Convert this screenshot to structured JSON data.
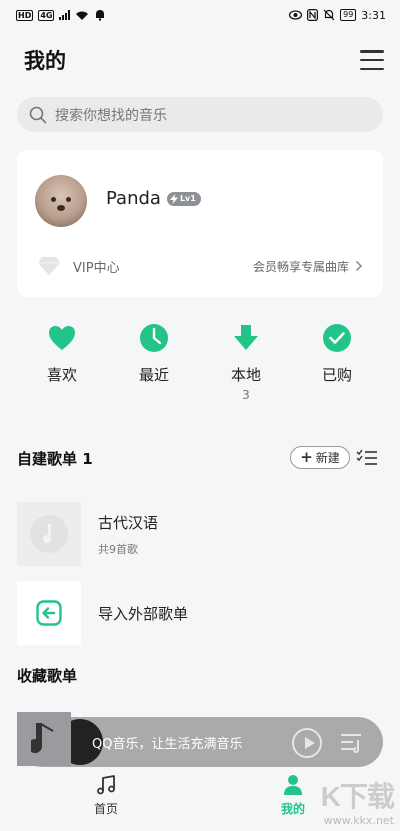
{
  "status_bar": {
    "network_tags": [
      "HD",
      "4G"
    ],
    "battery": "99",
    "time": "3:31"
  },
  "header": {
    "title": "我的",
    "menu_icon": "hamburger-menu-icon"
  },
  "search": {
    "placeholder": "搜索你想找的音乐"
  },
  "profile": {
    "username": "Panda",
    "level_badge": "Lv1",
    "vip_label": "VIP中心",
    "vip_promo": "会员畅享专属曲库"
  },
  "quick_actions": [
    {
      "label": "喜欢",
      "icon": "heart-icon",
      "count": ""
    },
    {
      "label": "最近",
      "icon": "clock-icon",
      "count": ""
    },
    {
      "label": "本地",
      "icon": "download-icon",
      "count": "3"
    },
    {
      "label": "已购",
      "icon": "check-circle-icon",
      "count": ""
    }
  ],
  "my_playlists": {
    "title": "自建歌单 1",
    "create_label": "新建",
    "items": [
      {
        "title": "古代汉语",
        "subtitle": "共9首歌"
      },
      {
        "title": "导入外部歌单",
        "subtitle": ""
      }
    ]
  },
  "collected": {
    "title": "收藏歌单"
  },
  "mini_player": {
    "text": "QQ音乐，让生活充满音乐"
  },
  "tabs": [
    {
      "label": "首页",
      "icon": "music-note-icon",
      "active": false
    },
    {
      "label": "我的",
      "icon": "person-icon",
      "active": true
    }
  ],
  "watermark": {
    "logo": "K下载",
    "url": "www.kkx.net"
  },
  "colors": {
    "accent": "#22c488",
    "background": "#f5f6f7",
    "card": "#ffffff",
    "mini_player": "#a9aaac"
  }
}
